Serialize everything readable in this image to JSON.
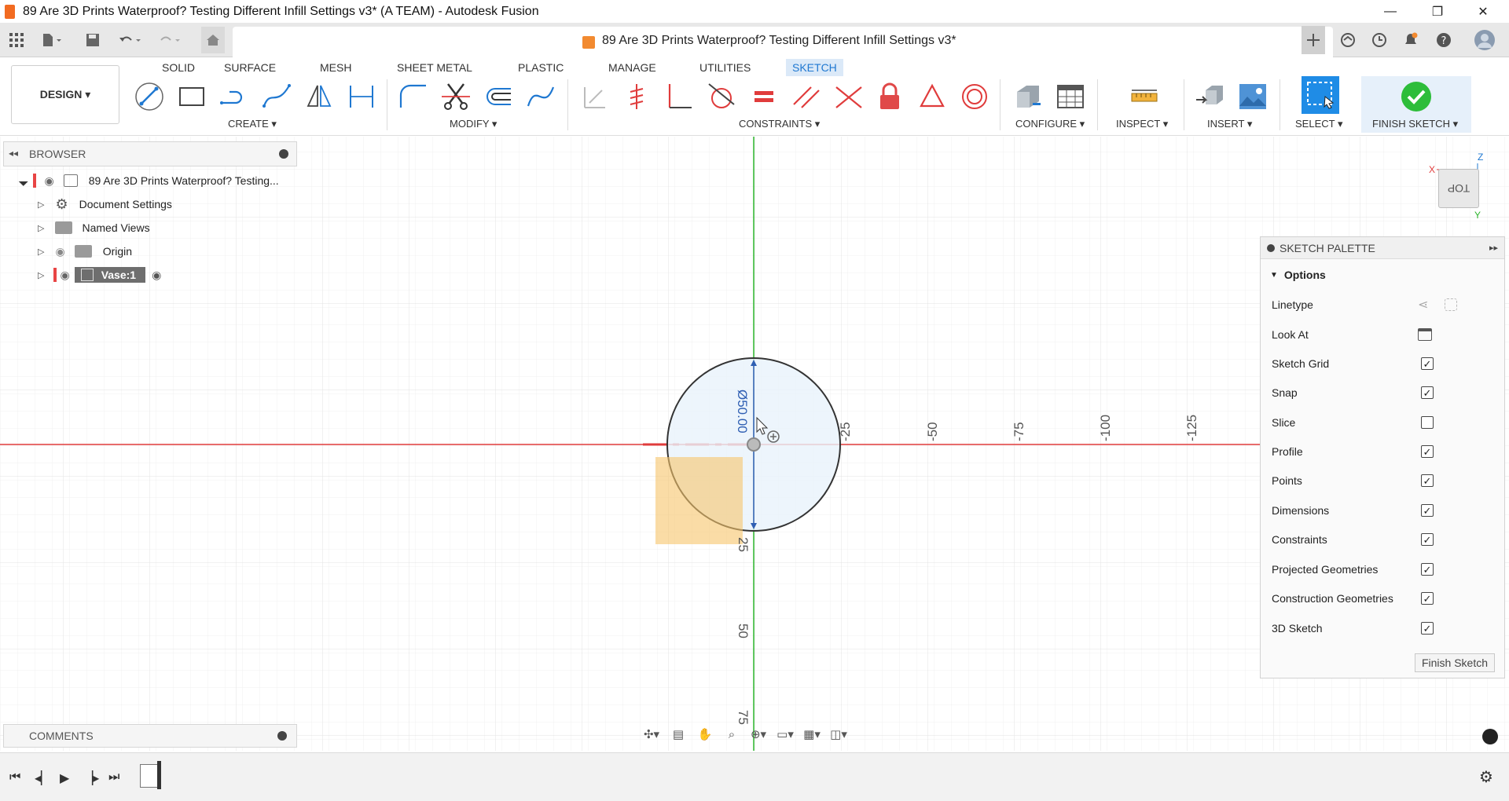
{
  "window": {
    "title": "89 Are 3D Prints Waterproof? Testing Different Infill Settings v3* (A TEAM) - Autodesk Fusion",
    "minimize": "—",
    "restore": "❐",
    "close": "✕"
  },
  "tabs": {
    "doc_title": "89 Are 3D Prints Waterproof? Testing Different Infill Settings v3*",
    "close": "✕"
  },
  "toolbar": {
    "workspace": "DESIGN ▾",
    "tabs": [
      "SOLID",
      "SURFACE",
      "MESH",
      "SHEET METAL",
      "PLASTIC",
      "MANAGE",
      "UTILITIES",
      "SKETCH"
    ],
    "active_tab": "SKETCH",
    "groups": {
      "create": "CREATE ▾",
      "modify": "MODIFY ▾",
      "constraints": "CONSTRAINTS ▾",
      "configure": "CONFIGURE ▾",
      "inspect": "INSPECT ▾",
      "insert": "INSERT ▾",
      "select": "SELECT ▾",
      "finish": "FINISH SKETCH ▾"
    }
  },
  "browser": {
    "header": "BROWSER",
    "items": [
      {
        "label": "89 Are 3D Prints Waterproof? Testing..."
      },
      {
        "label": "Document Settings"
      },
      {
        "label": "Named Views"
      },
      {
        "label": "Origin"
      },
      {
        "label": "Vase:1"
      }
    ]
  },
  "comments": {
    "label": "COMMENTS"
  },
  "canvas": {
    "dimension": "Ø50.00",
    "x_ticks": [
      "-25",
      "-50",
      "-75",
      "-100",
      "-125"
    ],
    "y_ticks": [
      "25",
      "50",
      "75"
    ],
    "viewcube": "TOP",
    "axis_x": "X",
    "axis_y": "Y",
    "axis_z": "Z"
  },
  "palette": {
    "header": "SKETCH PALETTE",
    "section": "Options",
    "rows": [
      {
        "label": "Linetype"
      },
      {
        "label": "Look At"
      },
      {
        "label": "Sketch Grid",
        "checked": true
      },
      {
        "label": "Snap",
        "checked": true
      },
      {
        "label": "Slice",
        "checked": false
      },
      {
        "label": "Profile",
        "checked": true
      },
      {
        "label": "Points",
        "checked": true
      },
      {
        "label": "Dimensions",
        "checked": true
      },
      {
        "label": "Constraints",
        "checked": true
      },
      {
        "label": "Projected Geometries",
        "checked": true
      },
      {
        "label": "Construction Geometries",
        "checked": true
      },
      {
        "label": "3D Sketch",
        "checked": true
      }
    ],
    "finish_button": "Finish Sketch"
  },
  "colors": {
    "accent": "#1f78d1",
    "x_axis": "#e03c3c",
    "y_axis": "#2db52d",
    "finish_green": "#2dbd3a",
    "lock_red": "#e04848"
  }
}
